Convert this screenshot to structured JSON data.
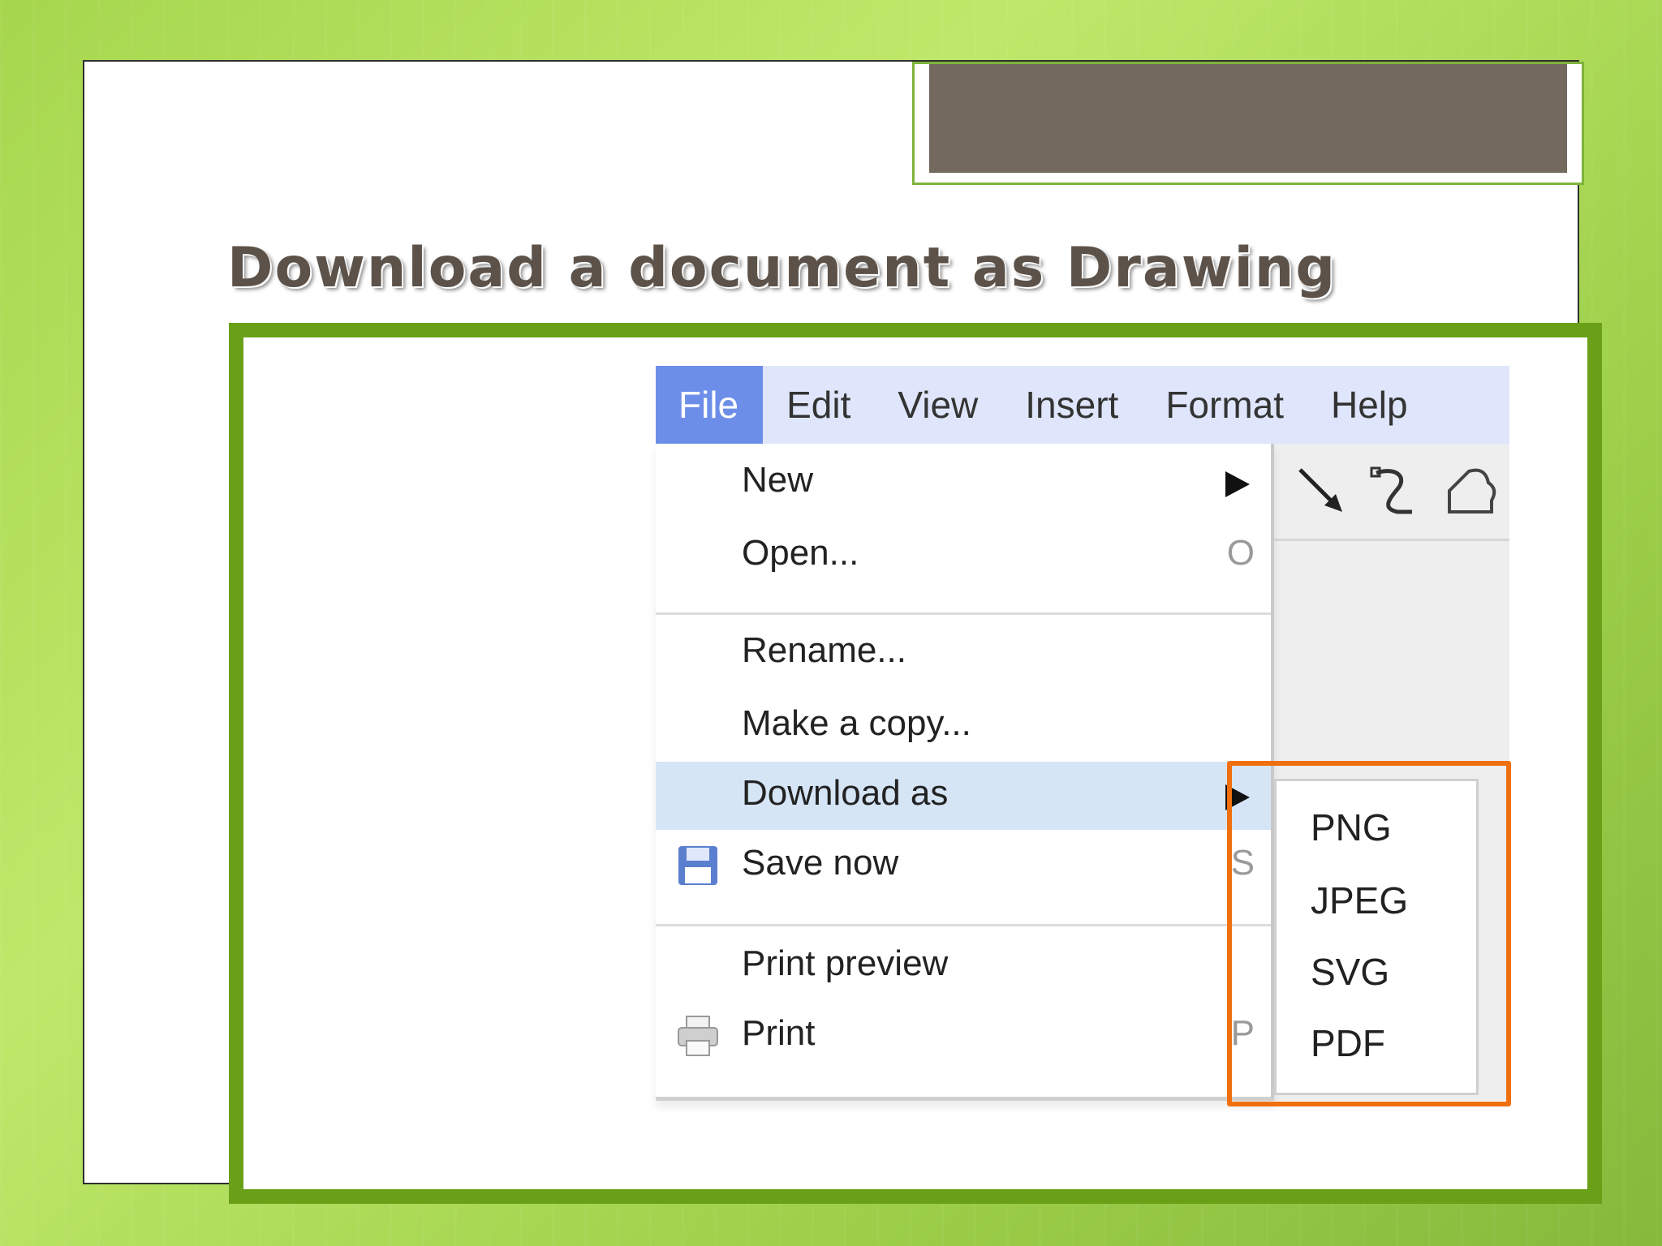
{
  "slide": {
    "title": "Download a document as Drawing"
  },
  "menubar": {
    "items": [
      "File",
      "Edit",
      "View",
      "Insert",
      "Format",
      "Help"
    ],
    "active": "File"
  },
  "file_menu": {
    "new": "New",
    "open": "Open...",
    "open_shortcut": "O",
    "rename": "Rename...",
    "make_copy": "Make a copy...",
    "download_as": "Download as",
    "save_now": "Save now",
    "save_shortcut": "S",
    "print_preview": "Print preview",
    "print": "Print",
    "print_shortcut": "P"
  },
  "download_submenu": {
    "items": [
      "PNG",
      "JPEG",
      "SVG",
      "PDF"
    ]
  },
  "toolbar": {
    "icons": [
      "line-arrow-icon",
      "curve-icon",
      "shape-icon"
    ]
  },
  "colors": {
    "highlight_box": "#f07010",
    "frame_green": "#6aa018",
    "menu_active": "#6c8ee8"
  }
}
